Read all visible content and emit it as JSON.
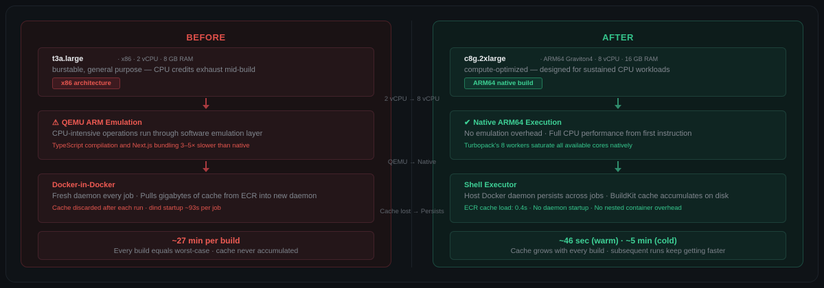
{
  "before": {
    "title": "BEFORE",
    "instance": {
      "name": "t3a.large",
      "spec": "· x86 · 2 vCPU · 8 GB RAM",
      "desc": "burstable, general purpose — CPU credits exhaust mid-build",
      "badge": "x86 architecture"
    },
    "step2": {
      "icon": "warning-icon",
      "title": "QEMU ARM Emulation",
      "desc": "CPU-intensive operations run through software emulation layer",
      "note": "TypeScript compilation and Next.js bundling 3–5× slower than native"
    },
    "step3": {
      "title": "Docker-in-Docker",
      "desc": "Fresh daemon every job · Pulls gigabytes of cache from ECR into new daemon",
      "note": "Cache discarded after each run · dind startup ~93s per job"
    },
    "result": {
      "headline": "~27 min per build",
      "sub": "Every build equals worst-case · cache never accumulated"
    }
  },
  "after": {
    "title": "AFTER",
    "instance": {
      "name": "c8g.2xlarge",
      "spec": "· ARM64 Graviton4 · 8 vCPU · 16 GB RAM",
      "desc": "compute-optimized — designed for sustained CPU workloads",
      "badge": "ARM64 native build"
    },
    "step2": {
      "icon": "check-icon",
      "title": "Native ARM64 Execution",
      "desc": "No emulation overhead · Full CPU performance from first instruction",
      "note": "Turbopack's 8 workers saturate all available cores natively"
    },
    "step3": {
      "title": "Shell Executor",
      "desc": "Host Docker daemon persists across jobs · BuildKit cache accumulates on disk",
      "note": "ECR cache load: 0.4s · No daemon startup · No nested container overhead"
    },
    "result": {
      "headline": "~46 sec (warm) · ~5 min (cold)",
      "sub": "Cache grows with every build · subsequent runs keep getting faster"
    }
  },
  "transitions": [
    "2 vCPU → 8 vCPU",
    "QEMU → Native",
    "Cache lost → Persists"
  ],
  "colors": {
    "before_accent": "#e0504a",
    "after_accent": "#34c28a"
  }
}
